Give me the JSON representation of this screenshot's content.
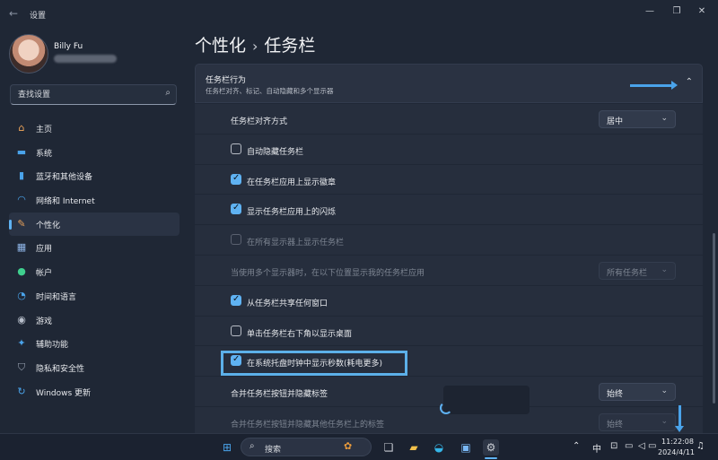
{
  "window": {
    "title": "设置"
  },
  "user": {
    "name": "Billy Fu"
  },
  "search": {
    "placeholder": "查找设置"
  },
  "nav": [
    {
      "label": "主页",
      "icon": "home-icon"
    },
    {
      "label": "系统",
      "icon": "monitor-icon"
    },
    {
      "label": "蓝牙和其他设备",
      "icon": "bluetooth-icon"
    },
    {
      "label": "网络和 Internet",
      "icon": "wifi-icon"
    },
    {
      "label": "个性化",
      "icon": "brush-icon",
      "active": true
    },
    {
      "label": "应用",
      "icon": "apps-icon"
    },
    {
      "label": "帐户",
      "icon": "person-icon"
    },
    {
      "label": "时间和语言",
      "icon": "globe-clock-icon"
    },
    {
      "label": "游戏",
      "icon": "gamepad-icon"
    },
    {
      "label": "辅助功能",
      "icon": "accessibility-icon"
    },
    {
      "label": "隐私和安全性",
      "icon": "shield-icon"
    },
    {
      "label": "Windows 更新",
      "icon": "update-icon"
    }
  ],
  "breadcrumb": {
    "parent": "个性化",
    "separator": "›",
    "current": "任务栏"
  },
  "section": {
    "title": "任务栏行为",
    "subtitle": "任务栏对齐、标记、自动隐藏和多个显示器"
  },
  "rows": [
    {
      "label": "任务栏对齐方式",
      "dropdown": "居中"
    },
    {
      "label": "自动隐藏任务栏",
      "checked": false
    },
    {
      "label": "在任务栏应用上显示徽章",
      "checked": true
    },
    {
      "label": "显示任务栏应用上的闪烁",
      "checked": true
    },
    {
      "label": "在所有显示器上显示任务栏",
      "checked": false,
      "disabled": true
    },
    {
      "label": "当使用多个显示器时，在以下位置显示我的任务栏应用",
      "dropdown": "所有任务栏",
      "disabled": true
    },
    {
      "label": "从任务栏共享任何窗口",
      "checked": true
    },
    {
      "label": "单击任务栏右下角以显示桌面",
      "checked": false
    },
    {
      "label": "在系统托盘时钟中显示秒数(耗电更多)",
      "checked": true
    },
    {
      "label": "合并任务栏按钮并隐藏标签",
      "dropdown": "始终"
    },
    {
      "label": "合并任务栏按钮并隐藏其他任务栏上的标签",
      "dropdown": "始终",
      "disabled": true
    }
  ],
  "taskbar": {
    "search_label": "搜索",
    "tray": {
      "ime": "中"
    },
    "clock": {
      "time": "11:22:08",
      "date": "2024/4/11"
    }
  },
  "colors": {
    "accent": "#5fb2f2",
    "highlight": "#5cb0e9",
    "background": "#1f2735"
  }
}
